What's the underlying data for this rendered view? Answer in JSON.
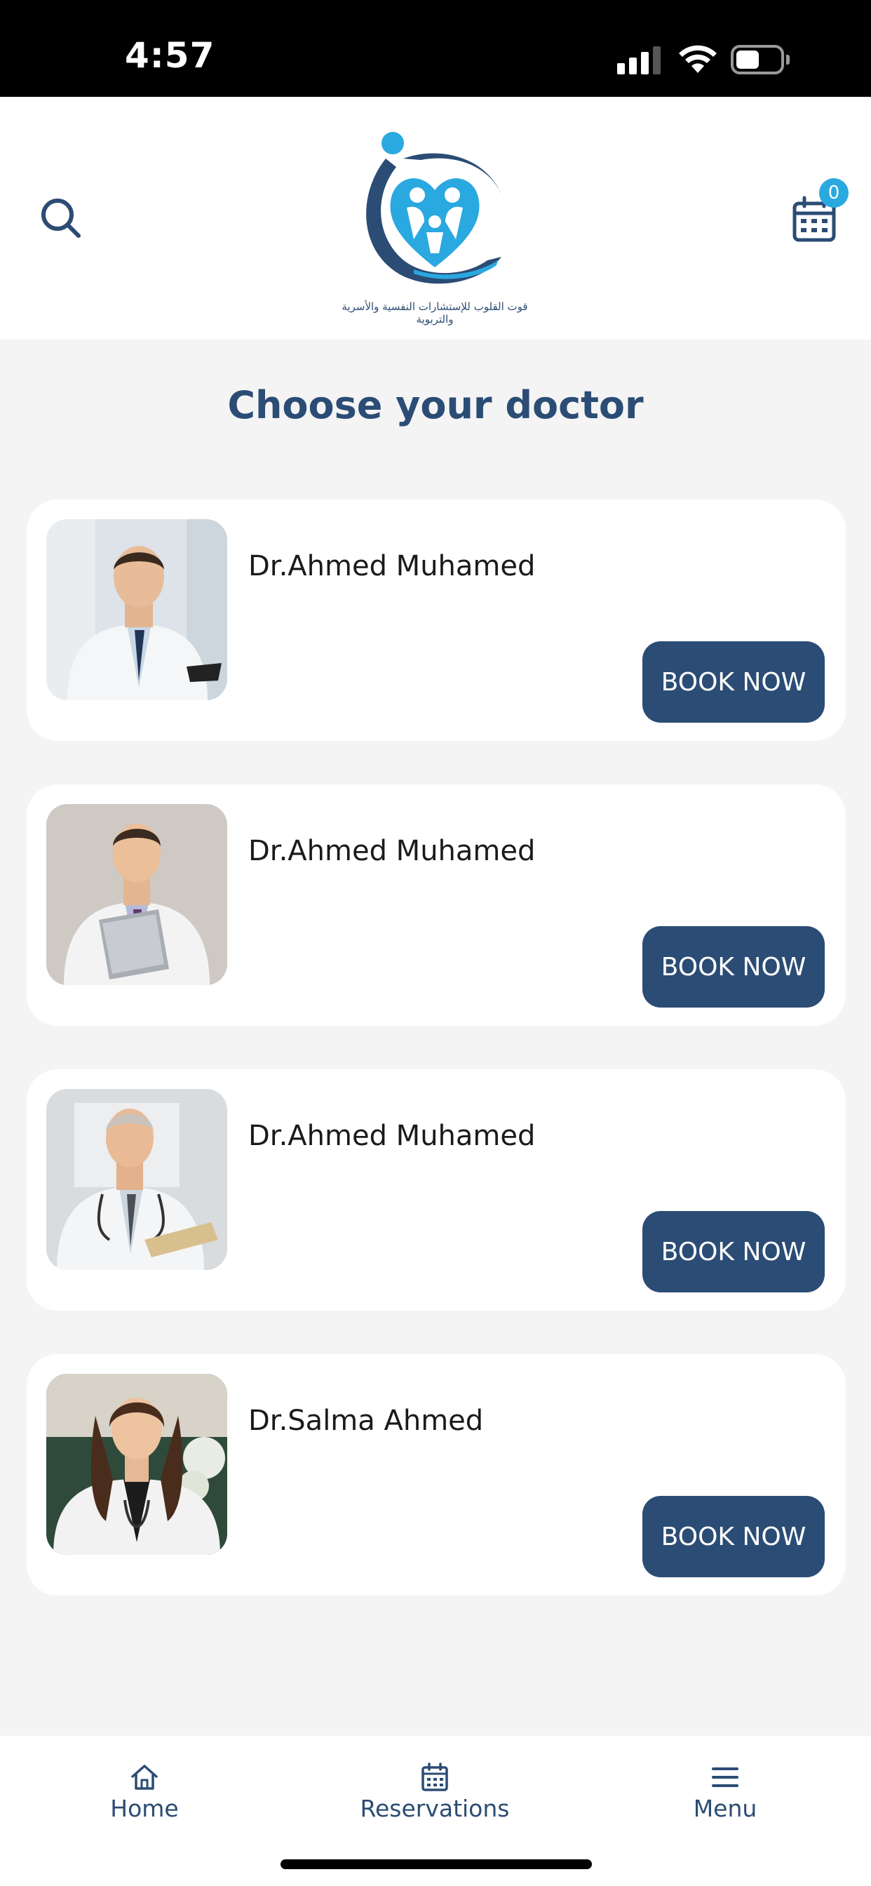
{
  "status_bar": {
    "time": "4:57"
  },
  "header": {
    "logo_caption": "قوت القلوب للإستشارات النفسية والأسرية والتربوية",
    "cart_count": "0"
  },
  "page_title": "Choose your doctor",
  "doctors": [
    {
      "name": "Dr.Ahmed Muhamed",
      "button": "BOOK NOW"
    },
    {
      "name": "Dr.Ahmed Muhamed",
      "button": "BOOK NOW"
    },
    {
      "name": "Dr.Ahmed Muhamed",
      "button": "BOOK NOW"
    },
    {
      "name": "Dr.Salma Ahmed",
      "button": "BOOK NOW"
    }
  ],
  "bottom_nav": [
    {
      "label": "Home",
      "icon": "home-icon"
    },
    {
      "label": "Reservations",
      "icon": "calendar-icon"
    },
    {
      "label": "Menu",
      "icon": "menu-icon"
    }
  ],
  "colors": {
    "primary": "#2b4c74",
    "accent": "#2aa8e0",
    "background": "#f4f4f5"
  }
}
